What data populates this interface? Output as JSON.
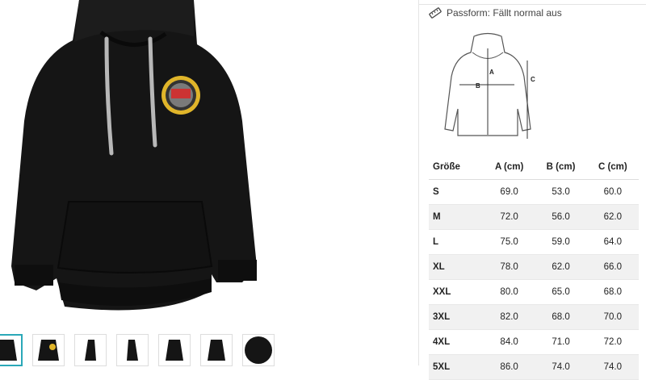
{
  "product": {
    "image_alt": "black hoodie with round badge",
    "thumbnails": [
      {
        "name": "front",
        "active": true
      },
      {
        "name": "front-alt",
        "active": false
      },
      {
        "name": "side-left",
        "active": false
      },
      {
        "name": "side-right",
        "active": false
      },
      {
        "name": "back-left",
        "active": false
      },
      {
        "name": "back-right",
        "active": false
      },
      {
        "name": "fabric-detail",
        "active": false
      }
    ]
  },
  "fit": {
    "icon": "ruler-icon",
    "label": "Passform: Fällt normal aus"
  },
  "diagram": {
    "labels": [
      "A",
      "B",
      "C"
    ]
  },
  "size_table": {
    "headers": [
      "Größe",
      "A (cm)",
      "B (cm)",
      "C (cm)"
    ],
    "rows": [
      [
        "S",
        "69.0",
        "53.0",
        "60.0"
      ],
      [
        "M",
        "72.0",
        "56.0",
        "62.0"
      ],
      [
        "L",
        "75.0",
        "59.0",
        "64.0"
      ],
      [
        "XL",
        "78.0",
        "62.0",
        "66.0"
      ],
      [
        "XXL",
        "80.0",
        "65.0",
        "68.0"
      ],
      [
        "3XL",
        "82.0",
        "68.0",
        "70.0"
      ],
      [
        "4XL",
        "84.0",
        "71.0",
        "72.0"
      ],
      [
        "5XL",
        "86.0",
        "74.0",
        "74.0"
      ]
    ]
  }
}
